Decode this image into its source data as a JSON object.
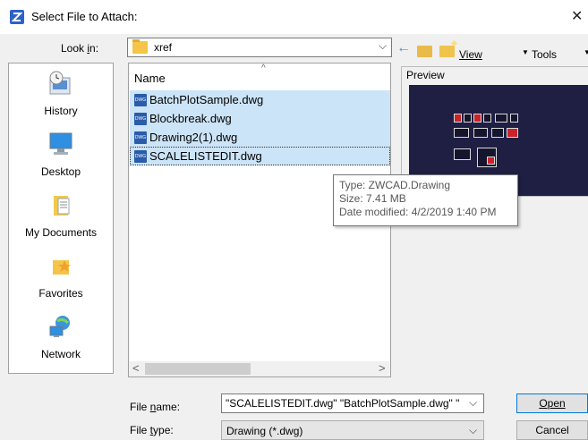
{
  "window": {
    "title": "Select File to Attach:",
    "close_glyph": "✕"
  },
  "lookin": {
    "label": "Look in:",
    "value": "xref",
    "chevron": "⌵"
  },
  "toolbar": {
    "back_glyph": "←",
    "view_label": "View",
    "tools_label": "Tools",
    "dropdown_glyph": "▼"
  },
  "places": [
    {
      "label": "History",
      "icon": "history-icon"
    },
    {
      "label": "Desktop",
      "icon": "desktop-icon"
    },
    {
      "label": "My Documents",
      "icon": "my-documents-icon"
    },
    {
      "label": "Favorites",
      "icon": "favorites-icon"
    },
    {
      "label": "Network",
      "icon": "network-icon"
    }
  ],
  "filelist": {
    "column_name": "Name",
    "sort_glyph": "^",
    "files": [
      {
        "name": "BatchPlotSample.dwg",
        "selected": true,
        "icon_text": "DWG"
      },
      {
        "name": "Blockbreak.dwg",
        "selected": true,
        "icon_text": "DWG"
      },
      {
        "name": "Drawing2(1).dwg",
        "selected": true,
        "icon_text": "DWG"
      },
      {
        "name": "SCALELISTEDIT.dwg",
        "selected": true,
        "icon_text": "DWG",
        "focused": true
      }
    ]
  },
  "scrollbar": {
    "left_glyph": "<",
    "right_glyph": ">"
  },
  "preview": {
    "label": "Preview",
    "background": "#1f1f44"
  },
  "tooltip": {
    "type_line": "Type: ZWCAD.Drawing",
    "size_line": "Size: 7.41 MB",
    "date_line": "Date modified: 4/2/2019 1:40 PM"
  },
  "filename": {
    "label": "File name:",
    "value": "\"SCALELISTEDIT.dwg\" \"BatchPlotSample.dwg\" \"",
    "chevron": "⌵"
  },
  "filetype": {
    "label": "File type:",
    "value": "Drawing (*.dwg)",
    "chevron": "⌵"
  },
  "buttons": {
    "open_label": "Open",
    "cancel_label": "Cancel"
  },
  "colors": {
    "selection": "#cce4f7",
    "accent": "#0078d7"
  }
}
